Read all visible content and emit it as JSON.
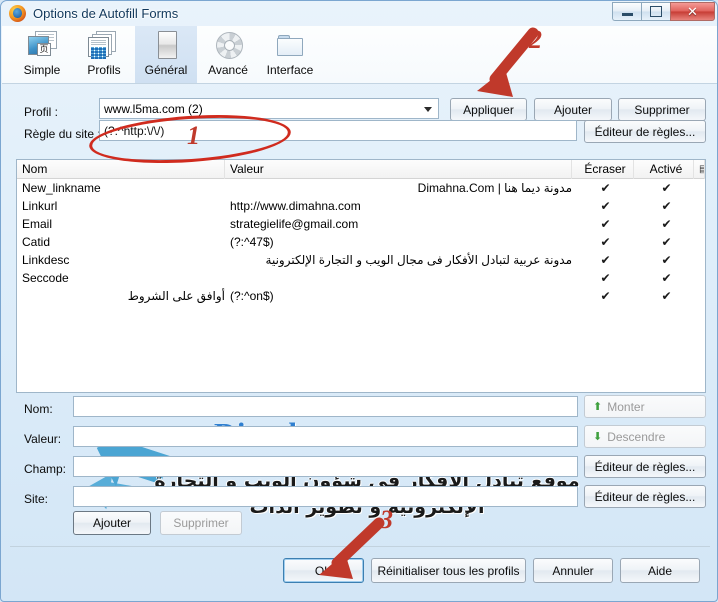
{
  "window": {
    "title": "Options de Autofill Forms",
    "app_icon": "firefox-icon",
    "controls": {
      "minimize": "minimize-icon",
      "maximize": "maximize-icon",
      "close": "close-icon"
    }
  },
  "toolbar": {
    "items": [
      {
        "label": "Simple",
        "icon": "simple-page-icon",
        "selected": false
      },
      {
        "label": "Profils",
        "icon": "profiles-stack-icon",
        "selected": false
      },
      {
        "label": "Général",
        "icon": "general-sheet-icon",
        "selected": true
      },
      {
        "label": "Avancé",
        "icon": "gear-icon",
        "selected": false
      },
      {
        "label": "Interface",
        "icon": "folder-icon",
        "selected": false
      }
    ]
  },
  "profile_row": {
    "label": "Profil :",
    "value": "www.l5ma.com (2)",
    "apply_label": "Appliquer",
    "add_label": "Ajouter",
    "delete_label": "Supprimer"
  },
  "site_rule_row": {
    "label": "Règle du site :",
    "value": "(?:^http:\\/\\/)",
    "editor_label": "Éditeur de règles..."
  },
  "list": {
    "columns": [
      "Nom",
      "Valeur",
      "Écraser",
      "Activé"
    ],
    "column_picker_icon": "column-chooser-icon",
    "check_glyph": "✔",
    "rows": [
      {
        "name": "New_linkname",
        "name_rtl": false,
        "value": "مدونة ديما هنا | Dimahna.Com",
        "value_rtl": true,
        "overwrite": true,
        "enabled": true
      },
      {
        "name": "Linkurl",
        "name_rtl": false,
        "value": "http://www.dimahna.com",
        "value_rtl": false,
        "overwrite": true,
        "enabled": true
      },
      {
        "name": "Email",
        "name_rtl": false,
        "value": "strategielife@gmail.com",
        "value_rtl": false,
        "overwrite": true,
        "enabled": true
      },
      {
        "name": "Catid",
        "name_rtl": false,
        "value": "(?:^47$)",
        "value_rtl": false,
        "overwrite": true,
        "enabled": true
      },
      {
        "name": "Linkdesc",
        "name_rtl": false,
        "value": "مدونة عربية لتبادل الأفكار فى مجال الويب و التجارة الإلكترونية",
        "value_rtl": true,
        "overwrite": true,
        "enabled": true
      },
      {
        "name": "Seccode",
        "name_rtl": false,
        "value": "",
        "value_rtl": false,
        "overwrite": true,
        "enabled": true
      },
      {
        "name": "أوافق على الشروط",
        "name_rtl": true,
        "value": "(?:^on$)",
        "value_rtl": false,
        "overwrite": true,
        "enabled": true
      }
    ]
  },
  "detail_fields": [
    {
      "label": "Nom:",
      "value": ""
    },
    {
      "label": "Valeur:",
      "value": ""
    },
    {
      "label": "Champ:",
      "value": ""
    },
    {
      "label": "Site:",
      "value": ""
    }
  ],
  "side_buttons": {
    "up_label": "Monter",
    "up_icon": "arrow-up-green-icon",
    "up_disabled": true,
    "down_label": "Descendre",
    "down_icon": "arrow-down-green-icon",
    "down_disabled": true,
    "field_editor_label": "Éditeur de règles...",
    "site_editor_label": "Éditeur de règles..."
  },
  "entry_buttons": {
    "add_label": "Ajouter",
    "delete_label": "Supprimer",
    "delete_disabled": true
  },
  "footer_buttons": {
    "ok_label": "OK",
    "reset_label": "Réinitialiser tous les profils",
    "cancel_label": "Annuler",
    "help_label": "Aide"
  },
  "watermark": {
    "brand": "Dimahna.net",
    "tagline_line1": "موقع تبادل الأفكار فى شؤون الويب و التجارة",
    "tagline_line2": "الإلكترونية و تطوير الذات",
    "logo_icon": "double-arrow-logo-icon",
    "brand_color": "#2f7fd0"
  },
  "annotations": {
    "color": "#c0392b",
    "items": [
      {
        "number": "1",
        "target": "site-rule-input"
      },
      {
        "number": "2",
        "target": "apply-button"
      },
      {
        "number": "3",
        "target": "ok-button"
      }
    ]
  }
}
